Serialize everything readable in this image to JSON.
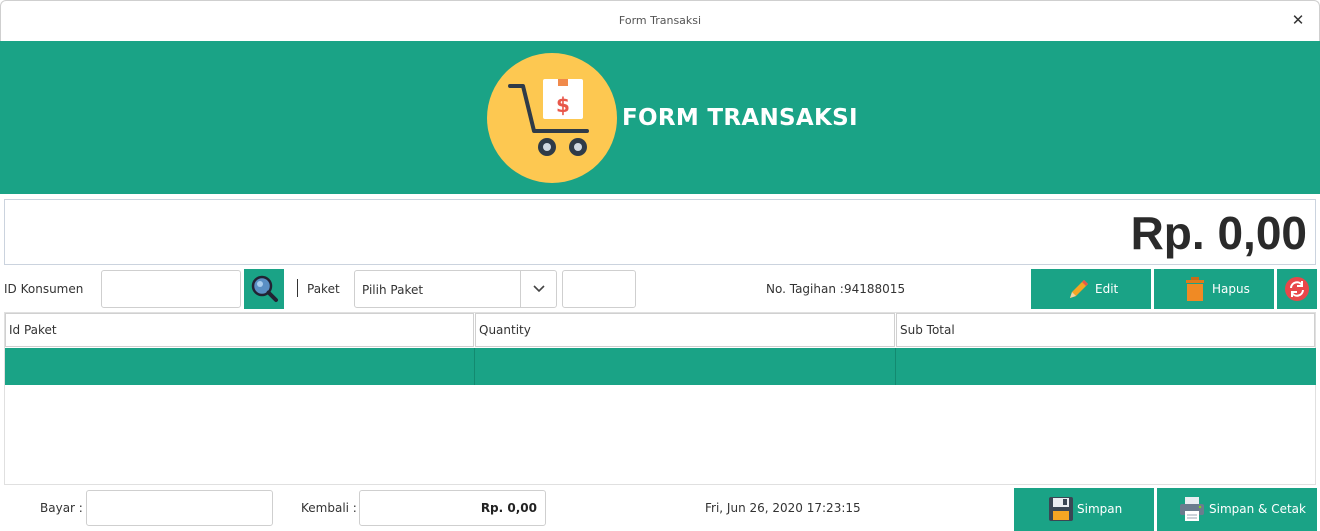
{
  "window": {
    "title": "Form Transaksi",
    "close_glyph": "✕"
  },
  "header": {
    "title": "FORM TRANSAKSI",
    "logo_icon": "shopping-cart-dollar-icon",
    "bg_color": "#1aa386",
    "logo_color": "#fdc851"
  },
  "total": {
    "amount": "Rp. 0,00"
  },
  "form": {
    "id_konsumen_label": "ID Konsumen",
    "id_konsumen_value": "",
    "search_icon": "magnifier-icon",
    "paket_label": "Paket",
    "paket_selected": "Pilih Paket",
    "paket_qty_value": "",
    "no_tagihan_label": "No. Tagihan :",
    "no_tagihan_value": "94188015"
  },
  "actions": {
    "edit_label": "Edit",
    "hapus_label": "Hapus",
    "refresh_icon": "refresh-icon"
  },
  "table": {
    "columns": [
      "Id Paket",
      "Quantity",
      "Sub Total"
    ],
    "rows": [
      [
        "",
        "",
        ""
      ]
    ]
  },
  "footer": {
    "bayar_label": "Bayar :",
    "bayar_value": "",
    "kembali_label": "Kembali :",
    "kembali_value": "Rp. 0,00",
    "datetime": "Fri, Jun 26, 2020 17:23:15",
    "simpan_label": "Simpan",
    "simpan_cetak_label": "Simpan & Cetak"
  }
}
